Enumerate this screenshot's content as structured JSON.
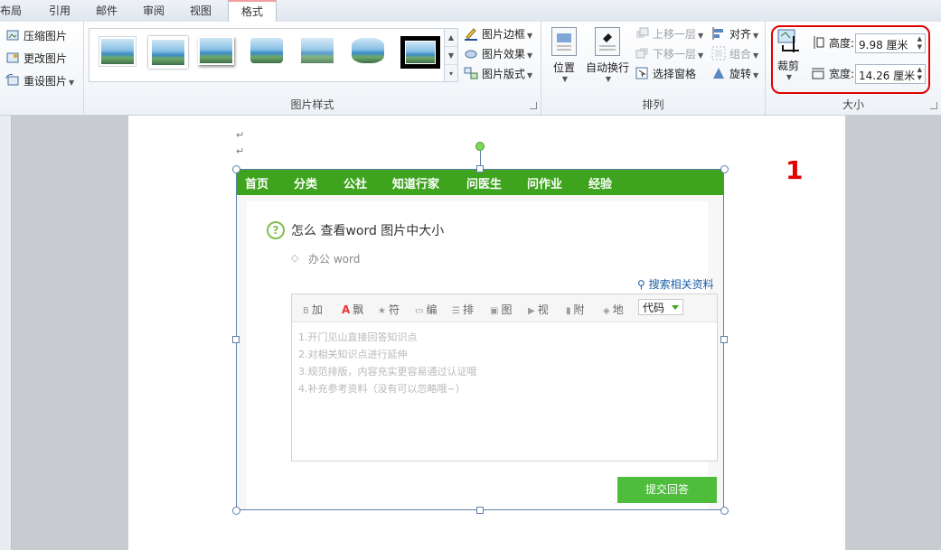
{
  "tabs": [
    "布局",
    "引用",
    "邮件",
    "审阅",
    "视图",
    "格式"
  ],
  "adjust": {
    "compress": "压缩图片",
    "change": "更改图片",
    "reset": "重设图片"
  },
  "styles": {
    "label": "图片样式",
    "border": "图片边框",
    "effects": "图片效果",
    "layout": "图片版式"
  },
  "arrange": {
    "label": "排列",
    "position": "位置",
    "wrap": "自动换行",
    "bring_forward": "上移一层",
    "send_backward": "下移一层",
    "selection_pane": "选择窗格",
    "align": "对齐",
    "group": "组合",
    "rotate": "旋转"
  },
  "size": {
    "label": "大小",
    "crop": "裁剪",
    "height_label": "高度:",
    "height_value": "9.98 厘米",
    "width_label": "宽度:",
    "width_value": "14.26 厘米"
  },
  "annotation": "1",
  "paragraph_mark": "↵",
  "picture": {
    "nav": [
      "首页",
      "分类",
      "公社",
      "知道行家",
      "问医生",
      "问作业",
      "经验"
    ],
    "question": "怎么 查看word 图片中大小",
    "tags": "办公    word",
    "search": "搜索相关资料",
    "toolbar": [
      "加",
      "飘",
      "符",
      "编",
      "排",
      "图",
      "视",
      "附",
      "地"
    ],
    "toolbar_bold": "B",
    "toolbar_font": "A",
    "code_select": "代码",
    "hints": [
      "1.开门见山直接回答知识点",
      "2.对相关知识点进行延伸",
      "3.规范排版，内容充实更容易通过认证哦",
      "4.补充参考资料（没有可以忽略哦~）"
    ],
    "submit": "提交回答"
  }
}
